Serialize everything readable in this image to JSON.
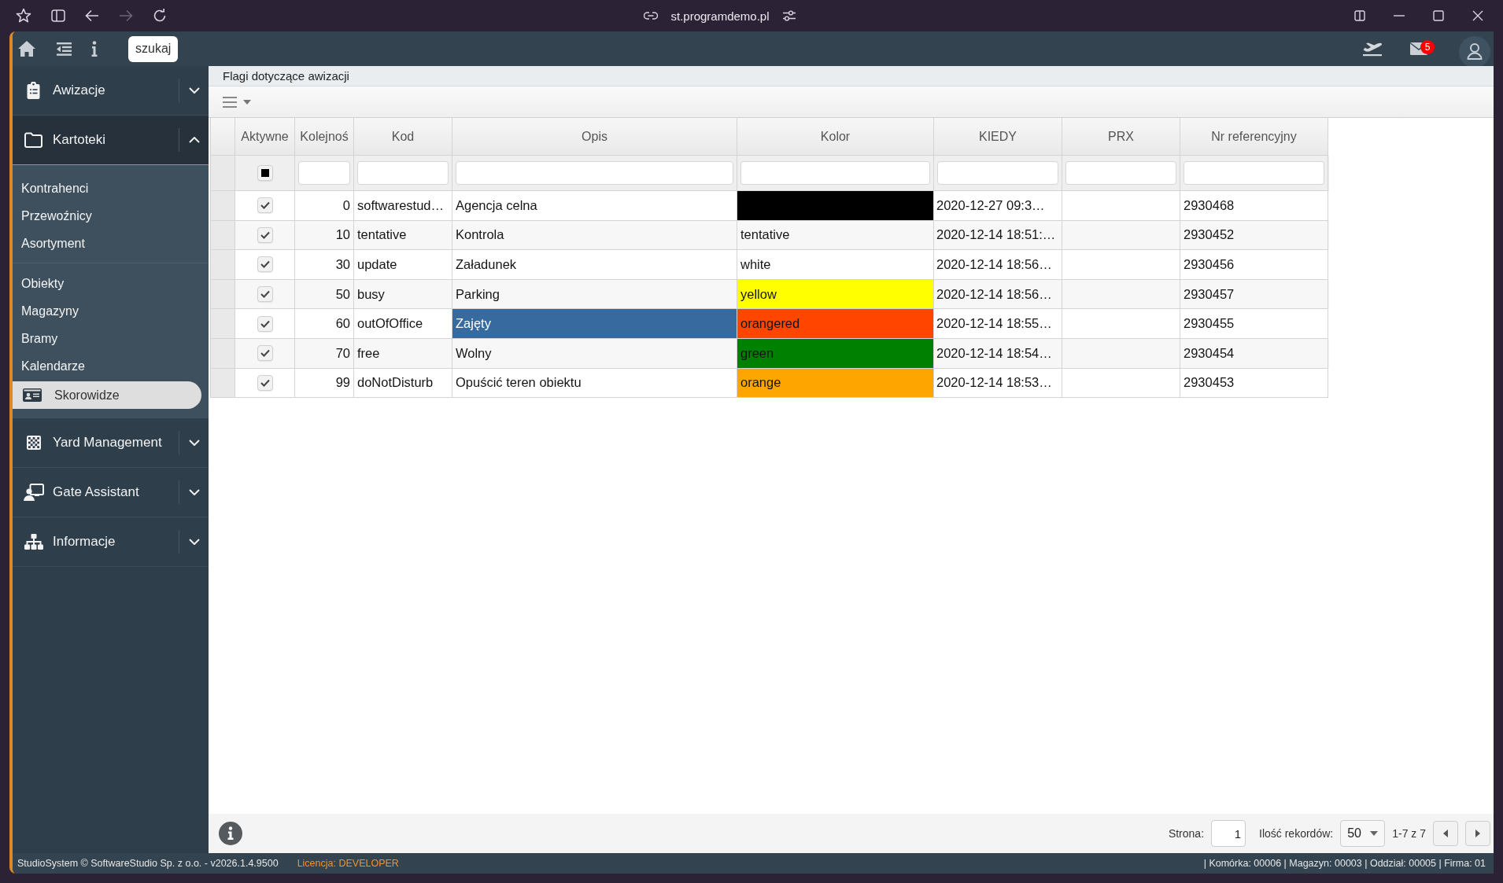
{
  "browser": {
    "url": "st.programdemo.pl",
    "forward_disabled": true
  },
  "header": {
    "search_button": "szukaj",
    "mail_count": "5"
  },
  "sidebar": {
    "sections": [
      {
        "label": "Awizacje",
        "expanded": false
      },
      {
        "label": "Kartoteki",
        "expanded": true,
        "groups": [
          {
            "items": [
              {
                "label": "Kontrahenci",
                "selected": false
              },
              {
                "label": "Przewoźnicy",
                "selected": false
              },
              {
                "label": "Asortyment",
                "selected": false
              }
            ]
          },
          {
            "items": [
              {
                "label": "Obiekty",
                "selected": false
              },
              {
                "label": "Magazyny",
                "selected": false
              },
              {
                "label": "Bramy",
                "selected": false
              },
              {
                "label": "Kalendarze",
                "selected": false
              },
              {
                "label": "Skorowidze",
                "selected": true
              }
            ]
          }
        ]
      },
      {
        "label": "Yard Management",
        "expanded": false
      },
      {
        "label": "Gate Assistant",
        "expanded": false
      },
      {
        "label": "Informacje",
        "expanded": false
      }
    ]
  },
  "page": {
    "title": "Flagi dotyczące awizacji"
  },
  "table": {
    "columns": [
      "Aktywne",
      "Kolejnoś",
      "Kod",
      "Opis",
      "Kolor",
      "KIEDY",
      "PRX",
      "Nr referencyjny"
    ],
    "filter_active": {
      "indeterminate": true
    },
    "rows": [
      {
        "active": true,
        "order": "0",
        "code": "softwarestud…",
        "description": "Agencja celna",
        "color": "#000000",
        "when": "2020-12-27 09:3…",
        "ref": "2930468",
        "selected": false
      },
      {
        "active": true,
        "order": "10",
        "code": "tentative",
        "description": "Kontrola",
        "color_label": "tentative",
        "when": "2020-12-14 18:51:…",
        "ref": "2930452",
        "selected": false
      },
      {
        "active": true,
        "order": "30",
        "code": "update",
        "description": "Załadunek",
        "color_label": "white",
        "when": "2020-12-14 18:56…",
        "ref": "2930456",
        "selected": false
      },
      {
        "active": true,
        "order": "50",
        "code": "busy",
        "description": "Parking",
        "color_label": "yellow",
        "color": "#ffff00",
        "when": "2020-12-14 18:56…",
        "ref": "2930457",
        "selected": false
      },
      {
        "active": true,
        "order": "60",
        "code": "outOfOffice",
        "description": "Zajęty",
        "color_label": "orangered",
        "color": "#ff4500",
        "when": "2020-12-14 18:55…",
        "ref": "2930455",
        "selected": true
      },
      {
        "active": true,
        "order": "70",
        "code": "free",
        "description": "Wolny",
        "color_label": "green",
        "color": "#008000",
        "when": "2020-12-14 18:54…",
        "ref": "2930454",
        "selected": false
      },
      {
        "active": true,
        "order": "99",
        "code": "doNotDisturb",
        "description": "Opuścić teren obiektu",
        "color_label": "orange",
        "color": "#ffa500",
        "when": "2020-12-14 18:53…",
        "ref": "2930453",
        "selected": false
      }
    ]
  },
  "pager": {
    "page_label": "Strona:",
    "page": "1",
    "size_label": "Ilość rekordów:",
    "size": "50",
    "range": "1-7 z 7"
  },
  "status_bar": {
    "copyright": "StudioSystem © SoftwareStudio Sp. z o.o. - v2026.1.4.9500",
    "license": "Licencja: DEVELOPER",
    "context": "| Komórka: 00006 | Magazyn: 00003 | Oddział: 00005 | Firma: 01"
  }
}
